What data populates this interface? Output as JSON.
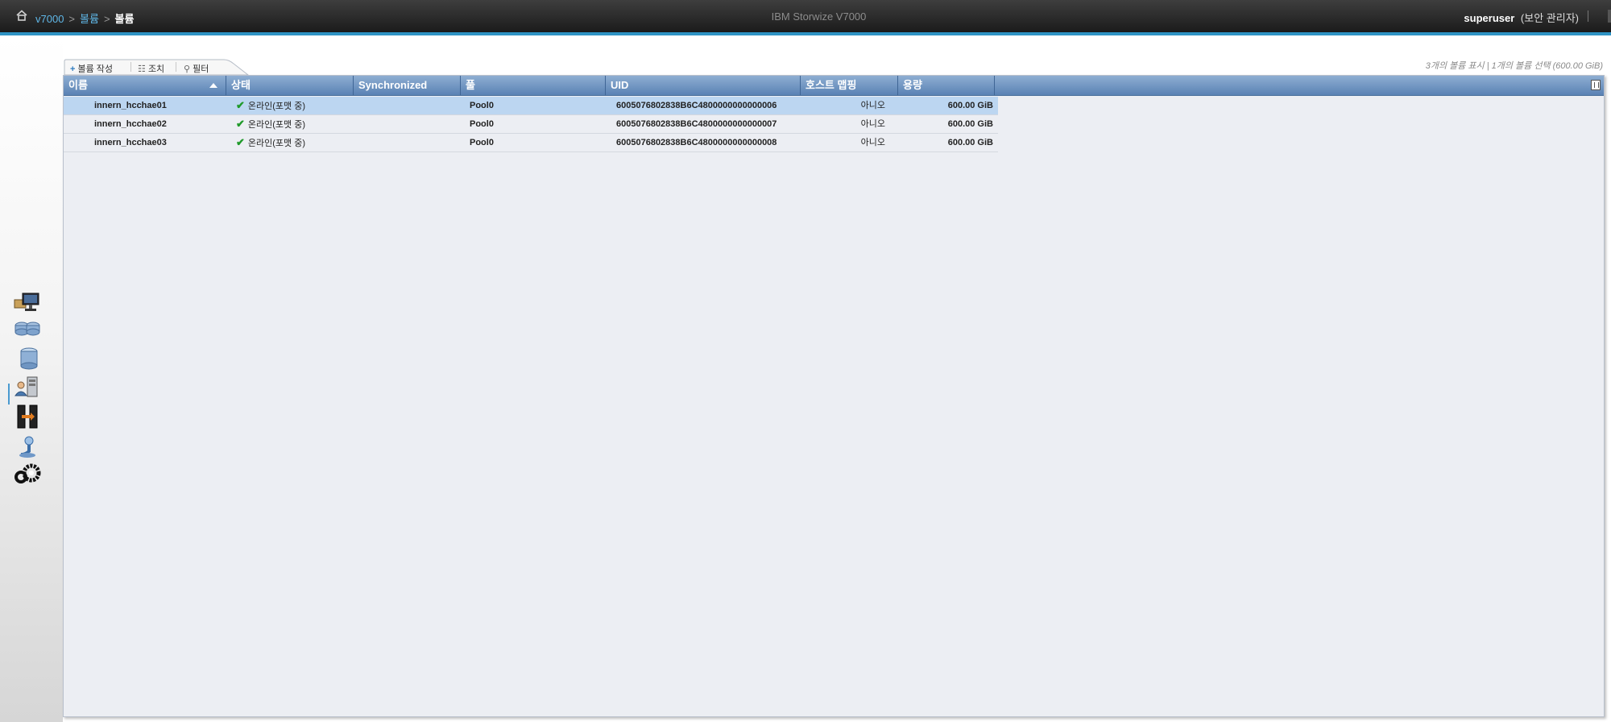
{
  "header": {
    "breadcrumb": [
      "v7000",
      "볼륨",
      "볼륨"
    ],
    "breadcrumb_separator": ">",
    "app_title": "IBM Storwize V7000",
    "user_name": "superuser",
    "user_role": "(보안 관리자)"
  },
  "nav": {
    "items": [
      "monitoring-icon",
      "pools-icon",
      "volumes-icon",
      "hosts-icon",
      "copy-services-icon",
      "access-icon",
      "settings-icon"
    ],
    "active": "volumes-icon"
  },
  "toolbar": {
    "create_volume": "볼륨 작성",
    "actions": "조치",
    "filter": "필터"
  },
  "summary": "3개의 볼륨 표시 | 1개의 볼륨 선택 (600.00 GiB)",
  "table": {
    "columns": [
      "이름",
      "상태",
      "Synchronized",
      "풀",
      "UID",
      "호스트 맵핑",
      "용량"
    ],
    "sort_column": "이름",
    "rows": [
      {
        "name": "innern_hcchae01",
        "status": "온라인(포맷 중)",
        "synchronized": "",
        "pool": "Pool0",
        "uid": "6005076802838B6C4800000000000006",
        "host_mapping": "아니오",
        "capacity": "600.00 GiB",
        "selected": true
      },
      {
        "name": "innern_hcchae02",
        "status": "온라인(포맷 중)",
        "synchronized": "",
        "pool": "Pool0",
        "uid": "6005076802838B6C4800000000000007",
        "host_mapping": "아니오",
        "capacity": "600.00 GiB",
        "selected": false
      },
      {
        "name": "innern_hcchae03",
        "status": "온라인(포맷 중)",
        "synchronized": "",
        "pool": "Pool0",
        "uid": "6005076802838B6C4800000000000008",
        "host_mapping": "아니오",
        "capacity": "600.00 GiB",
        "selected": false
      }
    ]
  },
  "colors": {
    "accent": "#2e93c4",
    "header_start": "#8eaed2",
    "header_end": "#5a82b4",
    "selected_row": "#bcd6f1",
    "status_ok": "#1f9a2a"
  }
}
